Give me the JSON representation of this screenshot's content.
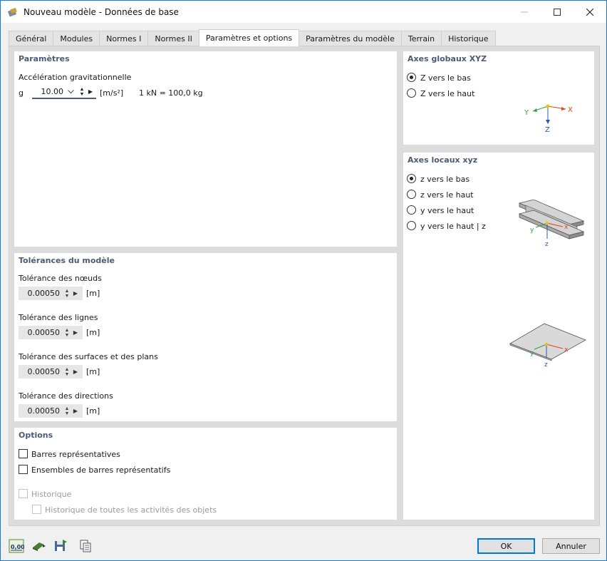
{
  "window": {
    "title": "Nouveau modèle - Données de base",
    "app_icon": "rfem-app-icon",
    "controls": {
      "minimize": "minimize-icon",
      "maximize": "maximize-icon",
      "close": "close-icon"
    }
  },
  "tabs": [
    {
      "label": "Général",
      "active": false
    },
    {
      "label": "Modules",
      "active": false
    },
    {
      "label": "Normes I",
      "active": false
    },
    {
      "label": "Normes II",
      "active": false
    },
    {
      "label": "Paramètres et options",
      "active": true
    },
    {
      "label": "Paramètres du modèle",
      "active": false
    },
    {
      "label": "Terrain",
      "active": false
    },
    {
      "label": "Historique",
      "active": false
    }
  ],
  "parametres": {
    "title": "Paramètres",
    "gravity_label": "Accélération gravitationnelle",
    "g_symbol": "g",
    "g_value": "10.00",
    "g_unit": "[m/s²]",
    "kn_note": "1 kN = 100,0 kg"
  },
  "tolerances": {
    "title": "Tolérances du modèle",
    "items": [
      {
        "label": "Tolérance des nœuds",
        "value": "0.00050",
        "unit": "[m]"
      },
      {
        "label": "Tolérance des lignes",
        "value": "0.00050",
        "unit": "[m]"
      },
      {
        "label": "Tolérance des surfaces et des plans",
        "value": "0.00050",
        "unit": "[m]"
      },
      {
        "label": "Tolérance des directions",
        "value": "0.00050",
        "unit": "[m]"
      }
    ]
  },
  "options": {
    "title": "Options",
    "barres": "Barres représentatives",
    "ensembles": "Ensembles de barres représentatifs",
    "historique": "Historique",
    "historique_toutes": "Historique de toutes les activités des objets"
  },
  "axes_globaux": {
    "title": "Axes globaux XYZ",
    "options": [
      {
        "label": "Z vers le bas",
        "checked": true
      },
      {
        "label": "Z vers le haut",
        "checked": false
      }
    ],
    "diagram_labels": {
      "x": "X",
      "y": "Y",
      "z": "Z"
    }
  },
  "axes_locaux": {
    "title": "Axes locaux xyz",
    "options": [
      {
        "label": "z vers le bas",
        "checked": true
      },
      {
        "label": "z vers le haut",
        "checked": false
      },
      {
        "label": "y vers le haut",
        "checked": false
      },
      {
        "label": "y vers le haut | z",
        "checked": false
      }
    ],
    "diagram_labels": {
      "x": "x",
      "y": "y",
      "z": "z"
    }
  },
  "footer": {
    "tools": [
      "units-icon",
      "model-icon",
      "save-icon",
      "copy-icon"
    ],
    "units_glyph": "0,00",
    "ok": "OK",
    "cancel": "Annuler"
  },
  "colors": {
    "accent": "#0078d7",
    "section_title": "#4d5a75",
    "axis_x": "#e0421b",
    "axis_y": "#2e9e3e",
    "axis_z": "#2857b8"
  }
}
